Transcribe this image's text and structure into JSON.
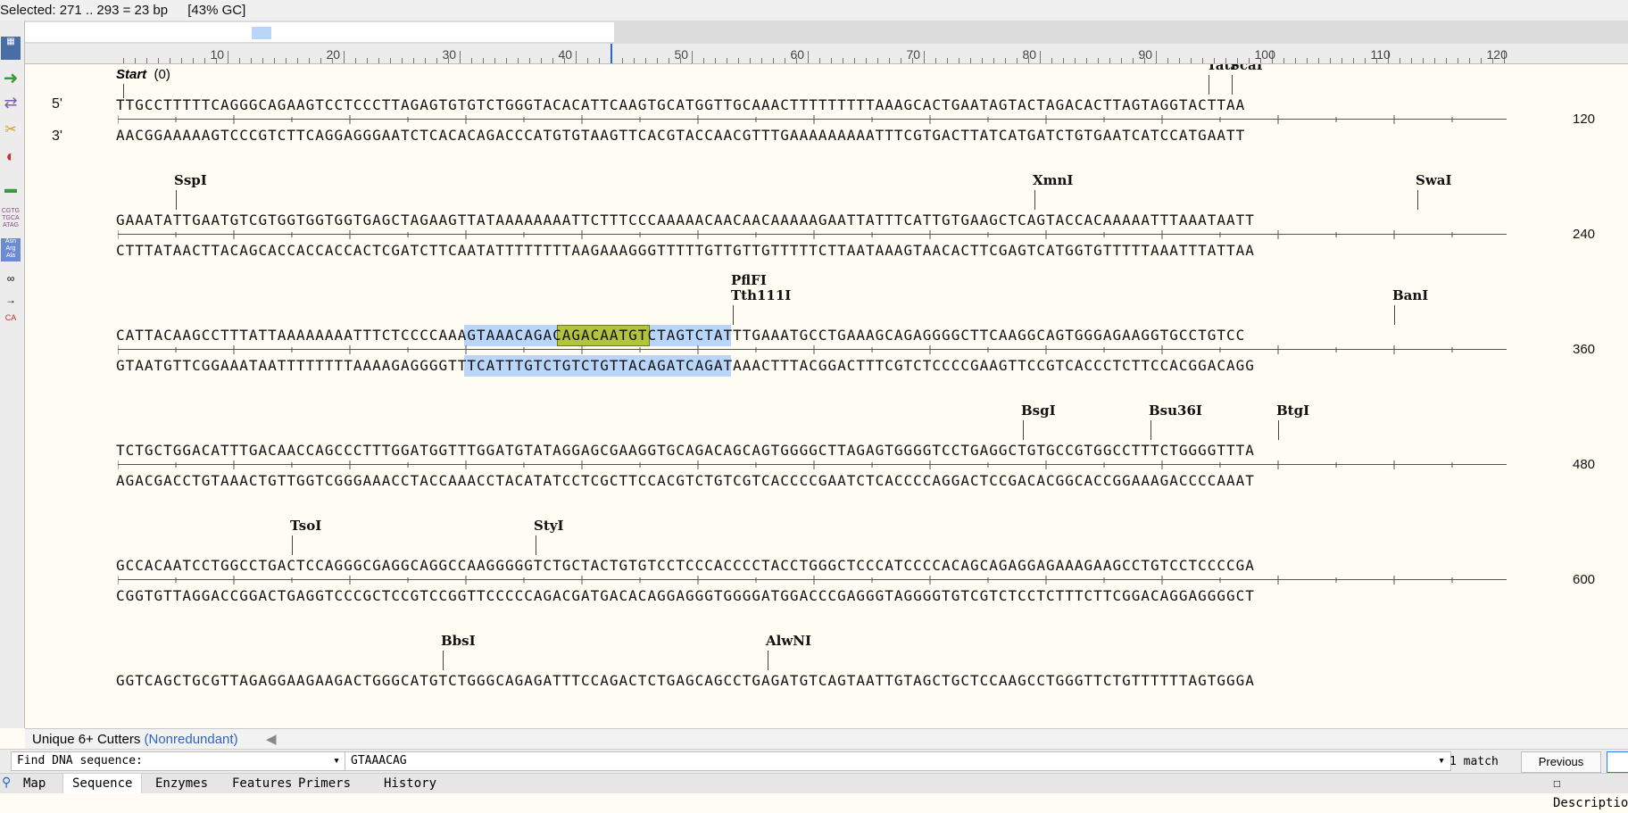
{
  "status": {
    "selected": "Selected: 271 .. 293 = 23 bp",
    "gc": "[43% GC]"
  },
  "ruler": {
    "labels": [
      "10",
      "20",
      "30",
      "40",
      "50",
      "60",
      "70",
      "80",
      "90",
      "100",
      "110",
      "120"
    ]
  },
  "strands": {
    "top": "5'",
    "bottom": "3'"
  },
  "start_marker": {
    "label": "Start",
    "value": "(0)"
  },
  "blocks": [
    {
      "top": "TTGCCTTTTTCAGGGCAGAAGTCCTCCCTTAGAGTGTGTCTGGGTACACATTCAAGTGCATGGTTGCAAACTTTTTTTTTAAAGCACTGAATAGTACTAGACACTTAGTAGGTACTTAA",
      "bottom": "AACGGAAAAAGTCCCGTCTTCAGGAGGGAATCTCACACAGACCCATGTGTAAGTTCACGTACCAACGTTTGAAAAAAAAATTTCGTGACTTATCATGATCTGTGAATCATCCATGAATT",
      "end": "120",
      "enzymes": [
        {
          "name": "TatI",
          "pos": 94
        },
        {
          "name": "ScaI",
          "pos": 96
        }
      ]
    },
    {
      "top": "GAAATATTGAATGTCGTGGTGGTGGTGAGCTAGAAGTTATAAAAAAAATTCTTTCCCAAAAACAACAACAAAAAGAATTATTTCATTGTGAAGCTCAGTACCACAAAAATTTAAATAATT",
      "bottom": "CTTTATAACTTACAGCACCACCACCACTCGATCTTCAATATTTTTTTTAAGAAAGGGTTTTTGTTGTTGTTTTTCTTAATAAAGTAACACTTCGAGTCATGGTGTTTTTAAATTTATTAA",
      "end": "240",
      "enzymes": [
        {
          "name": "SspI",
          "pos": 5
        },
        {
          "name": "XmnI",
          "pos": 79
        },
        {
          "name": "SwaI",
          "pos": 112
        }
      ]
    },
    {
      "top": "CATTACAAGCCTTTATTAAAAAAAATTTCTCCCCAAAGTAAACAGACAGACAATGTCTAGTCTATTTGAAATGCCTGAAAGCAGAGGGGCTTCAAGGCAGTGGGAGAAGGTGCCTGTCC",
      "bottom": "GTAATGTTCGGAAATAATTTTTTTTAAAAGAGGGGTTTCATTTGTCTGTCTGTTACAGATCAGATAAACTTTACGGACTTTCGTCTCCCCGAAGTTCCGTCACCCTCTTCCACGGACAGG",
      "end": "360",
      "enzymes": [
        {
          "name": "PflFI",
          "pos": 53,
          "row": 0
        },
        {
          "name": "Tth111I",
          "pos": 53,
          "row": 1
        },
        {
          "name": "BanI",
          "pos": 110,
          "row": 1
        }
      ]
    },
    {
      "top": "TCTGCTGGACATTTGACAACCAGCCCTTTGGATGGTTTGGATGTATAGGAGCGAAGGTGCAGACAGCAGTGGGGCTTAGAGTGGGGTCCTGAGGCTGTGCCGTGGCCTTTCTGGGGTTTA",
      "bottom": "AGACGACCTGTAAACTGTTGGTCGGGAAACCTACCAAACCTACATATCCTCGCTTCCACGTCTGTCGTCACCCCGAATCTCACCCCAGGACTCCGACACGGCACCGGAAAGACCCCAAAT",
      "end": "480",
      "enzymes": [
        {
          "name": "BsgI",
          "pos": 78
        },
        {
          "name": "Bsu36I",
          "pos": 89
        },
        {
          "name": "BtgI",
          "pos": 100
        }
      ]
    },
    {
      "top": "GCCACAATCCTGGCCTGACTCCAGGGCGAGGCAGGCCAAGGGGGTCTGCTACTGTGTCCTCCCACCCCTACCTGGGCTCCCATCCCCACAGCAGAGGAGAAAGAAGCCTGTCCTCCCCGA",
      "bottom": "CGGTGTTAGGACCGGACTGAGGTCCCGCTCCGTCCGGTTCCCCCAGACGATGACACAGGAGGGTGGGGATGGACCCGAGGGTAGGGGTGTCGTCTCCTCTTTCTTCGGACAGGAGGGGCT",
      "end": "600",
      "enzymes": [
        {
          "name": "TsoI",
          "pos": 15
        },
        {
          "name": "StyI",
          "pos": 36
        }
      ]
    },
    {
      "top": "GGTCAGCTGCGTTAGAGGAAGAAGACTGGGCATGTCTGGGCAGAGATTTCCAGACTCTGAGCAGCCTGAGATGTCAGTAATTGTAGCTGCTCCAAGCCTGGGTTCTGTTTTTTAGTGGGA",
      "bottom": "",
      "end": "",
      "enzymes": [
        {
          "name": "BbsI",
          "pos": 28
        },
        {
          "name": "AlwNI",
          "pos": 56
        }
      ]
    }
  ],
  "selection": {
    "block": 2,
    "top_from": 30,
    "top_to": 53,
    "bottom_from": 30,
    "bottom_to": 53,
    "match_from": 38,
    "match_to": 46
  },
  "bottom_tabs": {
    "label": "Unique 6+ Cutters",
    "sub": "(Nonredundant)"
  },
  "find": {
    "mode": "Find DNA sequence:",
    "query": "GTAAACAG",
    "count": "1 match",
    "previous": "Previous"
  },
  "nav_tabs": [
    "Map",
    "Sequence",
    "Enzymes",
    "Features",
    "Primers",
    "History"
  ],
  "nav_active": "Sequence",
  "description_label": "Descriptio",
  "colors": {
    "selection": "#b9d6fa",
    "match": "#b2c43d"
  }
}
